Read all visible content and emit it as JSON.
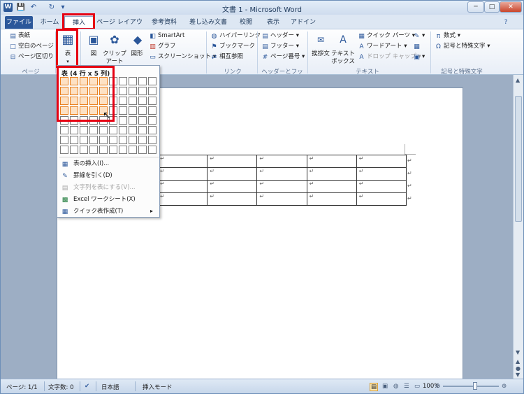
{
  "window": {
    "title": "文書 1 - Microsoft Word",
    "logo_letter": "W",
    "controls": {
      "minimize": "─",
      "maximize": "□",
      "close": "✕"
    }
  },
  "qat": {
    "save": "💾",
    "undo": "↶",
    "repeat": "↻",
    "customize": "▾"
  },
  "tabs": [
    {
      "label": "ファイル"
    },
    {
      "label": "ホーム"
    },
    {
      "label": "挿入"
    },
    {
      "label": "ページ レイアウト"
    },
    {
      "label": "参考資料"
    },
    {
      "label": "差し込み文書"
    },
    {
      "label": "校閲"
    },
    {
      "label": "表示"
    },
    {
      "label": "アドイン"
    }
  ],
  "ribbon_help": "?",
  "ribbon": {
    "page_group": {
      "label": "ページ",
      "cover": "表紙",
      "blank": "空白のページ",
      "break": "ページ区切り"
    },
    "table_group": {
      "table": "表"
    },
    "illustrations": {
      "picture": "図",
      "clipart_1": "クリップ",
      "clipart_2": "アート",
      "shapes": "図形",
      "smartart": "SmartArt",
      "chart": "グラフ",
      "screenshot": "スクリーンショット"
    },
    "links": {
      "label": "リンク",
      "hyperlink": "ハイパーリンク",
      "bookmark": "ブックマーク",
      "crossref": "相互参照"
    },
    "header_footer": {
      "label": "ヘッダーとフッター",
      "header": "ヘッダー",
      "footer": "フッター",
      "page_number": "ページ番号"
    },
    "text": {
      "label": "テキスト",
      "greeting": "挨拶文",
      "textbox_1": "テキスト",
      "textbox_2": "ボックス",
      "quickparts": "クイック パーツ",
      "wordart": "ワードアート",
      "dropcap": "ドロップ キャップ"
    },
    "symbols": {
      "label": "記号と特殊文字",
      "equation": "数式",
      "symbol": "記号と特殊文字"
    }
  },
  "table_menu": {
    "title": "表 (4 行 x 5 列)",
    "selected_rows": 4,
    "selected_cols": 5,
    "items": [
      {
        "label": "表の挿入(I)...",
        "icon": "table-insert-icon",
        "enabled": true
      },
      {
        "label": "罫線を引く(D)",
        "icon": "pencil-icon",
        "enabled": true
      },
      {
        "label": "文字列を表にする(V)...",
        "icon": "convert-icon",
        "enabled": false
      },
      {
        "label": "Excel ワークシート(X)",
        "icon": "excel-icon",
        "enabled": true
      },
      {
        "label": "クイック表作成(T)",
        "icon": "quick-table-icon",
        "enabled": true,
        "submenu": "▸"
      }
    ]
  },
  "document": {
    "cell_mark": "↵",
    "rows": 4,
    "cols": 5
  },
  "status": {
    "page": "ページ: 1/1",
    "words": "文字数: 0",
    "language": "日本語",
    "mode": "挿入モード",
    "zoom": "100%"
  },
  "colors": {
    "file_tab": "#2b579a",
    "highlight": "#e60012",
    "grid_selected": "#fde1c4"
  }
}
